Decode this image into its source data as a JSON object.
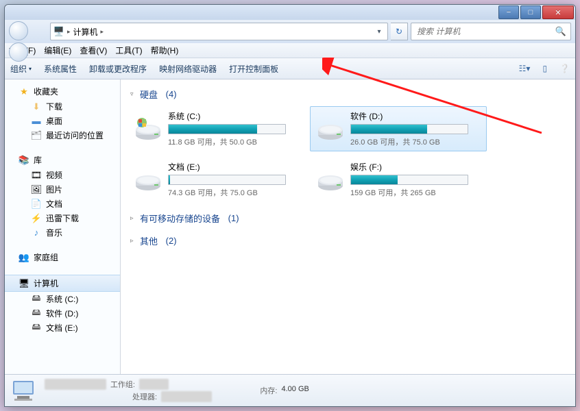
{
  "titlebar": {
    "min": "−",
    "max": "□",
    "close": "✕"
  },
  "address": {
    "root": "计算机",
    "sep": "▸"
  },
  "search": {
    "placeholder": "搜索 计算机"
  },
  "menu": {
    "file": "文件(F)",
    "edit": "编辑(E)",
    "view": "查看(V)",
    "tools": "工具(T)",
    "help": "帮助(H)"
  },
  "toolbar": {
    "organize": "组织",
    "properties": "系统属性",
    "uninstall": "卸载或更改程序",
    "mapdrive": "映射网络驱动器",
    "controlpanel": "打开控制面板"
  },
  "sidebar": {
    "favorites": {
      "label": "收藏夹"
    },
    "fav_items": [
      {
        "label": "下载"
      },
      {
        "label": "桌面"
      },
      {
        "label": "最近访问的位置"
      }
    ],
    "libraries": {
      "label": "库"
    },
    "lib_items": [
      {
        "label": "视频"
      },
      {
        "label": "图片"
      },
      {
        "label": "文档"
      },
      {
        "label": "迅雷下载"
      },
      {
        "label": "音乐"
      }
    ],
    "homegroup": {
      "label": "家庭组"
    },
    "computer": {
      "label": "计算机"
    },
    "comp_items": [
      {
        "label": "系统 (C:)"
      },
      {
        "label": "软件 (D:)"
      },
      {
        "label": "文档 (E:)"
      }
    ]
  },
  "groups": {
    "hdd_label": "硬盘",
    "hdd_count": "(4)",
    "removable_label": "有可移动存储的设备",
    "removable_count": "(1)",
    "other_label": "其他",
    "other_count": "(2)"
  },
  "drives": [
    {
      "name": "系统 (C:)",
      "free": "11.8 GB 可用，共 50.0 GB",
      "pct": 76,
      "selected": false,
      "os": true
    },
    {
      "name": "软件 (D:)",
      "free": "26.0 GB 可用，共 75.0 GB",
      "pct": 65,
      "selected": true,
      "os": false
    },
    {
      "name": "文档 (E:)",
      "free": "74.3 GB 可用，共 75.0 GB",
      "pct": 1,
      "selected": false,
      "os": false
    },
    {
      "name": "娱乐 (F:)",
      "free": "159 GB 可用，共 265 GB",
      "pct": 40,
      "selected": false,
      "os": false
    }
  ],
  "status": {
    "workgroup_lbl": "工作组:",
    "workgroup_val": "████",
    "cpu_lbl": "处理器:",
    "cpu_val": "████████",
    "mem_lbl": "内存:",
    "mem_val": "4.00 GB",
    "title_blur": "██████████"
  }
}
